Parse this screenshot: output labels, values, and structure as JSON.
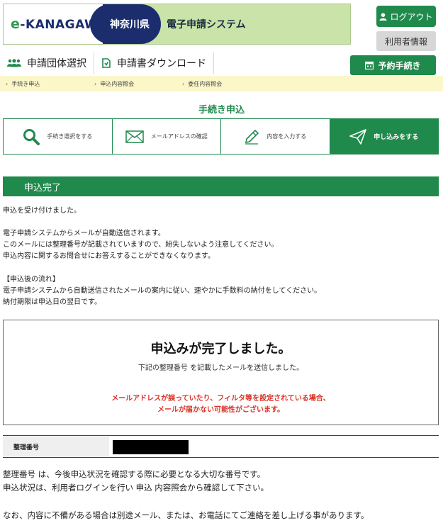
{
  "header": {
    "logo_text_e": "e",
    "logo_text_rest": "-KANAGAWA",
    "prefecture": "神奈川県",
    "system_name": "電子申請システム",
    "logout_label": "ログアウト",
    "user_info_label": "利用者情報",
    "reservation_label": "予約手続き"
  },
  "nav": {
    "items": [
      {
        "label": "申請団体選択"
      },
      {
        "label": "申請書ダウンロード"
      }
    ]
  },
  "breadcrumb": {
    "items": [
      "手続き申込",
      "申込内容照会",
      "委任内容照会"
    ]
  },
  "page_title": "手続き申込",
  "steps": [
    {
      "label": "手続き選択をする",
      "icon": "search-icon"
    },
    {
      "label": "メールアドレスの確認",
      "icon": "mail-icon"
    },
    {
      "label": "内容を入力する",
      "icon": "pencil-icon"
    },
    {
      "label": "申し込みをする",
      "icon": "send-icon",
      "active": true
    }
  ],
  "section_title": "申込完了",
  "body": {
    "received": "申込を受け付けました。",
    "mail_lines": [
      "電子申請システムからメールが自動送信されます。",
      "このメールには整理番号が記載されていますので、紛失しないよう注意してください。",
      "申込内容に関するお問合せにお答えすることができなくなります。"
    ],
    "flow_heading": "【申込後の流れ】",
    "flow_lines": [
      "電子申請システムから自動送信されたメールの案内に従い、速やかに手数料の納付をしてください。",
      "納付期限は申込日の翌日です。"
    ]
  },
  "complete_box": {
    "title": "申込みが完了しました。",
    "subtitle": "下記の整理番号 を記載したメールを送信しました。",
    "warning_line1": "メールアドレスが誤っていたり、フィルタ等を設定されている場合、",
    "warning_line2": "メールが届かない可能性がございます。"
  },
  "reference": {
    "label": "整理番号",
    "value": ""
  },
  "footer": {
    "line1": "整理番号 は、今後申込状況を確認する際に必要となる大切な番号です。",
    "line2": "申込状況は、利用者ログインを行い 申込 内容照会から確認して下さい。",
    "line3": "なお、内容に不備がある場合は別途メール、または、お電話にてご連絡を差し上げる事があります。"
  },
  "colors": {
    "brand_green": "#1f8a4c",
    "logo_green_bg": "#c9e3a8",
    "navy": "#1c2d6e",
    "warning_red": "#d93025",
    "breadcrumb_bg": "#fbf7c9"
  }
}
